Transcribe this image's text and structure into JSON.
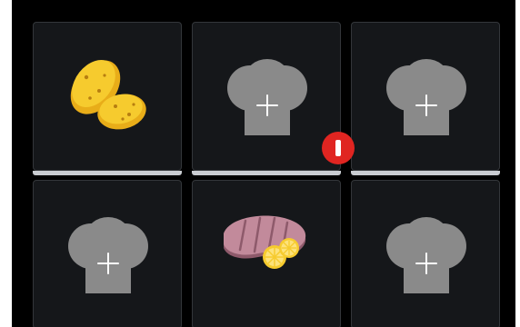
{
  "recipe_slots": [
    {
      "slot": 1,
      "content": "potatoes",
      "icon": "potatoes-icon",
      "has_bar": true
    },
    {
      "slot": 2,
      "content": "empty",
      "icon": "chef-hat-plus-icon",
      "has_bar": true
    },
    {
      "slot": 3,
      "content": "empty",
      "icon": "chef-hat-plus-icon",
      "has_bar": true
    },
    {
      "slot": 4,
      "content": "empty",
      "icon": "chef-hat-plus-icon",
      "has_bar": false
    },
    {
      "slot": 5,
      "content": "steak",
      "icon": "steak-lemon-icon",
      "has_bar": false
    },
    {
      "slot": 6,
      "content": "empty",
      "icon": "chef-hat-plus-icon",
      "has_bar": false
    }
  ],
  "alert": {
    "icon": "alert-badge-icon",
    "color": "#e02521"
  },
  "colors": {
    "background": "#000000",
    "tile": "#15171a",
    "tile_border": "#33363a",
    "hat": "#8a8a8a",
    "bar": "#c9ccd1",
    "potato": "#f1c22a",
    "steak": "#b57a8c",
    "lemon": "#f7d232"
  }
}
